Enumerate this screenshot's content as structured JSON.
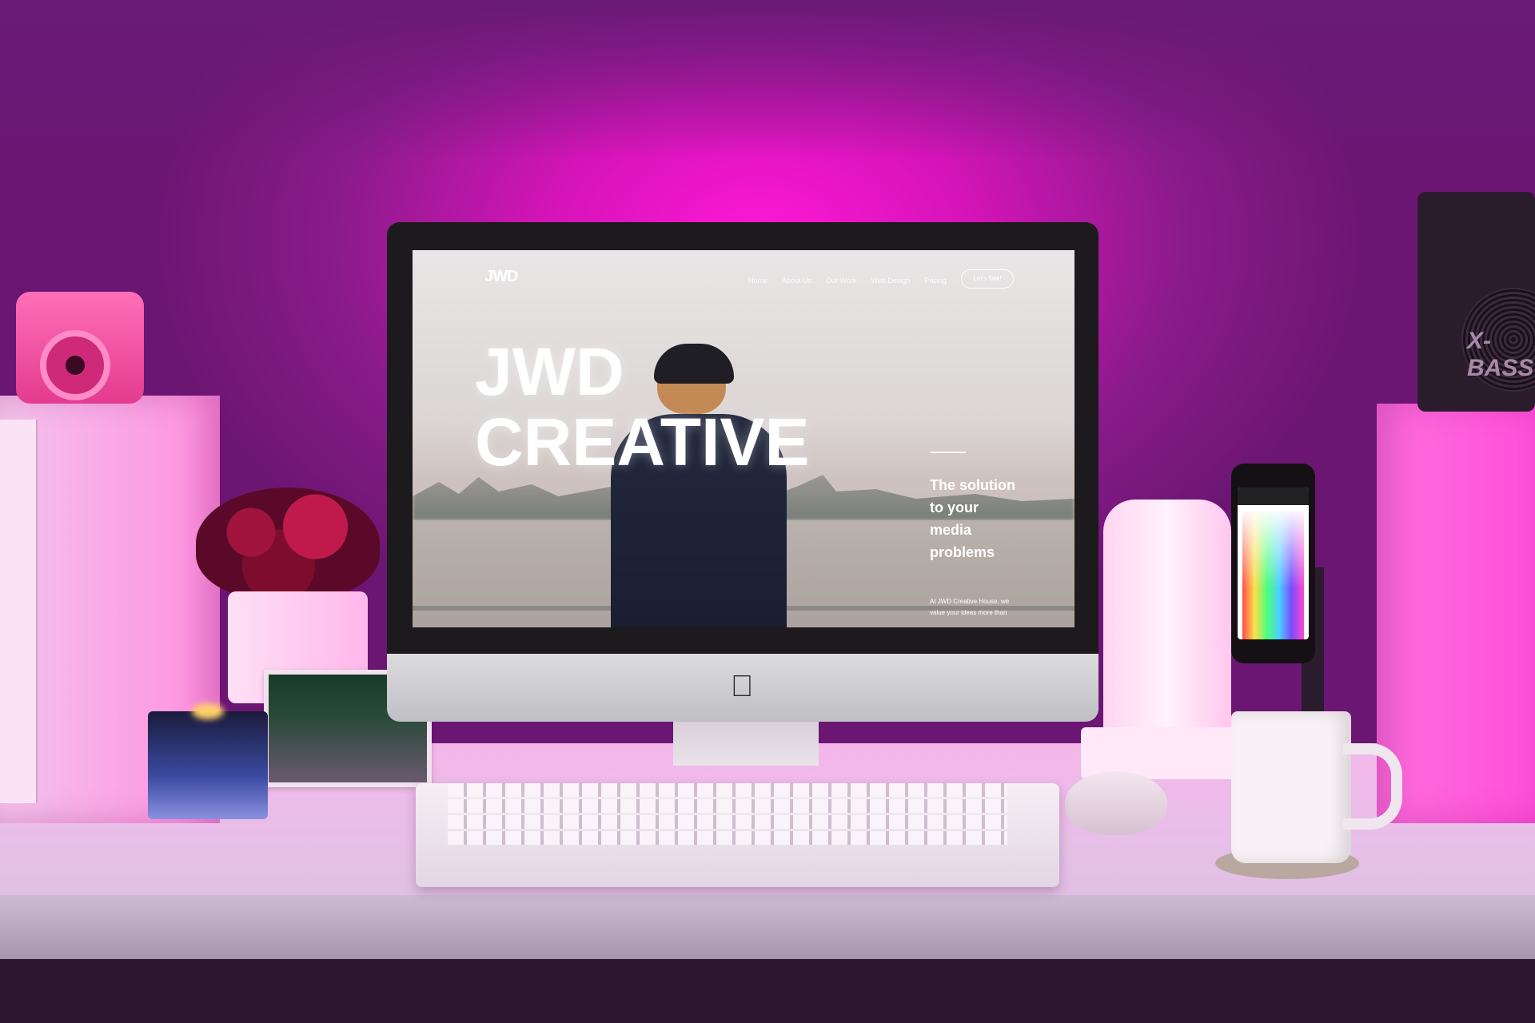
{
  "screen_site": {
    "logo": "JWD",
    "nav": [
      "Home",
      "About Us",
      "Our Work",
      "Web Design",
      "Pricing"
    ],
    "cta": "Let's Talk!",
    "hero_line1": "JWD",
    "hero_line2": "CREATIVE",
    "tagline": "The solution to your media problems",
    "body_text": "At JWD Creative House, we value your ideas more than"
  },
  "speaker": {
    "brand": "X-BASS"
  },
  "colors": {
    "ambient_light": "#ff18d6",
    "wall": "#6b1673"
  }
}
